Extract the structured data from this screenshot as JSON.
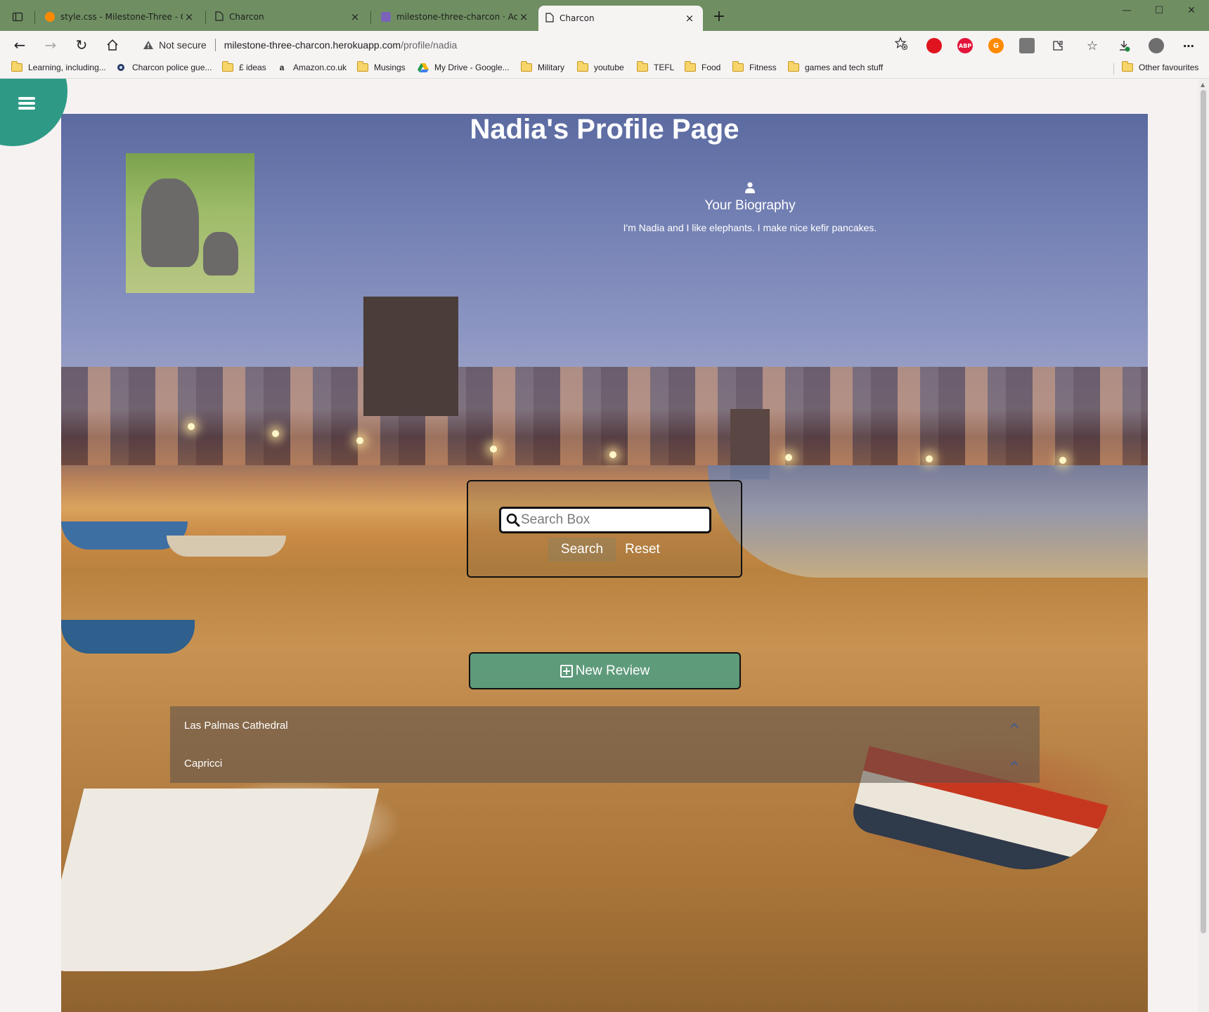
{
  "browser": {
    "tabs": [
      {
        "title": "style.css - Milestone-Three - Gitp",
        "favicon": "gitpod-icon"
      },
      {
        "title": "Charcon",
        "favicon": "page-icon"
      },
      {
        "title": "milestone-three-charcon · Activit",
        "favicon": "heroku-icon"
      },
      {
        "title": "Charcon",
        "favicon": "page-icon",
        "active": true
      }
    ],
    "new_tab": "+",
    "address": {
      "security_label": "Not secure",
      "url_host": "milestone-three-charcon.herokuapp.com",
      "url_path": "/profile/nadia"
    },
    "bookmarks": [
      {
        "label": "Learning, including...",
        "icon": "folder-icon"
      },
      {
        "label": "Charcon police gue...",
        "icon": "eye-icon"
      },
      {
        "label": "£ ideas",
        "icon": "folder-icon"
      },
      {
        "label": "Amazon.co.uk",
        "icon": "amazon-icon"
      },
      {
        "label": "Musings",
        "icon": "folder-icon"
      },
      {
        "label": "My Drive - Google...",
        "icon": "drive-icon"
      },
      {
        "label": "Military",
        "icon": "folder-icon"
      },
      {
        "label": "youtube",
        "icon": "folder-icon"
      },
      {
        "label": "TEFL",
        "icon": "folder-icon"
      },
      {
        "label": "Food",
        "icon": "folder-icon"
      },
      {
        "label": "Fitness",
        "icon": "folder-icon"
      },
      {
        "label": "games and tech stuff",
        "icon": "folder-icon"
      }
    ],
    "other_favourites": "Other favourites",
    "extensions": [
      {
        "name": "opera-icon",
        "color": "#e0141e",
        "glyph": ""
      },
      {
        "name": "adblock-icon",
        "color": "#e3143a",
        "glyph": "ABP"
      },
      {
        "name": "gitpod-icon",
        "color": "#ff8a00",
        "glyph": "G"
      },
      {
        "name": "collections-icon",
        "color": "#777777",
        "glyph": ""
      },
      {
        "name": "extensions-icon",
        "color": "#444444",
        "glyph": ""
      }
    ]
  },
  "page": {
    "title": "Nadia's Profile Page",
    "bio_title": "Your Biography",
    "bio_text": "I'm Nadia and I like elephants. I make nice kefir pancakes.",
    "search": {
      "placeholder": "Search Box",
      "search_label": "Search",
      "reset_label": "Reset"
    },
    "new_review_label": "New Review",
    "reviews": [
      {
        "title": "Las Palmas Cathedral"
      },
      {
        "title": "Capricci"
      }
    ],
    "accent_color": "#2e9a86"
  }
}
